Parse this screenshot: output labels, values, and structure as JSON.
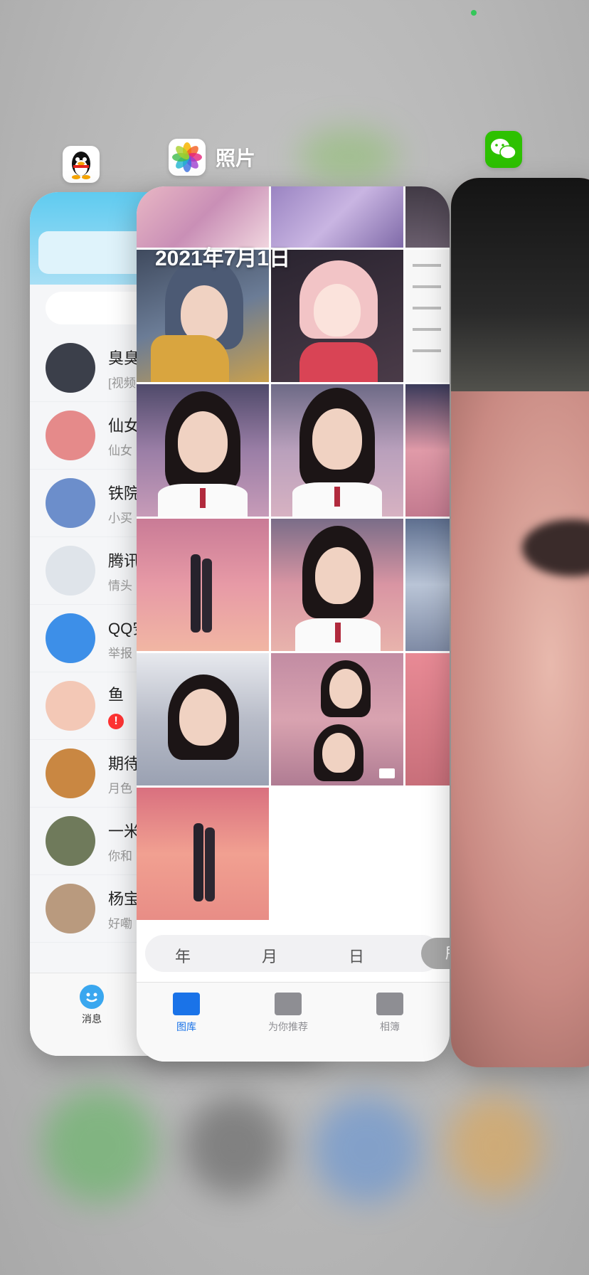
{
  "status": {
    "indicator_color": "#34c759"
  },
  "apps": {
    "qq": {
      "icon": "qq-penguin-icon",
      "conversations": [
        {
          "name": "臭臭",
          "preview": "[视频"
        },
        {
          "name": "仙女",
          "preview": "仙女"
        },
        {
          "name": "铁院",
          "preview": "小买"
        },
        {
          "name": "腾讯",
          "preview": "情头"
        },
        {
          "name": "QQ安",
          "preview": "举报"
        },
        {
          "name": "鱼",
          "preview": "!"
        },
        {
          "name": "期待",
          "preview": "月色"
        },
        {
          "name": "一米",
          "preview": "你和"
        },
        {
          "name": "杨宝",
          "preview": "好嘞"
        }
      ],
      "tab": {
        "label": "消息"
      }
    },
    "photos": {
      "title": "照片",
      "date_header": "2021年7月1日",
      "segments": {
        "year": "年",
        "month": "月",
        "day": "日",
        "all": "所"
      },
      "tabs": {
        "library": "图库",
        "for_you": "为你推荐",
        "albums": "相簿"
      },
      "accent": "#1a73e8"
    },
    "wechat": {
      "icon": "wechat-icon",
      "brand_color": "#2dc100"
    }
  }
}
